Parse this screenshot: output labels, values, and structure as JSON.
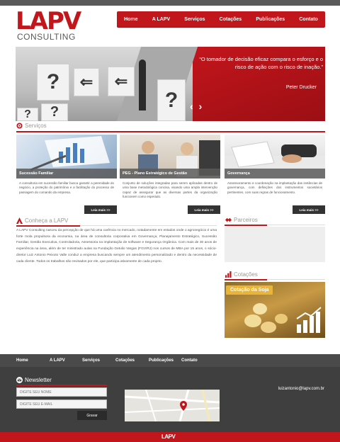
{
  "logo": {
    "mark": "LAPV",
    "subtitle": "CONSULTING"
  },
  "nav": [
    "Home",
    "A LAPV",
    "Serviços",
    "Cotações",
    "Publicações",
    "Contato"
  ],
  "banner": {
    "quote": "“O tomador de decisão eficaz compara o esforço e o risco de ação com o risco de inação.”",
    "author": "Peter Drucker"
  },
  "services": {
    "title": "Serviços",
    "cards": [
      {
        "caption": "Sucessão Familiar",
        "text": "A consultoria em sucessão familiar busca garantir a perenidade do negócio, a proteção do patrimônio e a facilitação do processo de passagem do comando da empresa.",
        "button": "Leia mais >>"
      },
      {
        "caption": "PEG - Plano Estratégico de Gestão",
        "text": "Conjunto de soluções integradas para serem aplicadas dentro de uma base metodológica concisa, visando uma ampla intervenção capaz de assegurar que as diversas partes da organização funcionem como esperado.",
        "button": "Leia mais >>"
      },
      {
        "caption": "Governança",
        "text": "Assessoramento e coordenação na implantação das instâncias de governança, com definições dos instrumentos societários pertinentes, com suas regras de funcionamento.",
        "button": "Leia mais >>"
      }
    ]
  },
  "about": {
    "title": "Conheça a LAPV",
    "text": "A LAPV Consulting nasceu da percepção de que há uma carência no mercado, notadamente em estados onde o agronegócio é uma forte mola propulsora da economia, na área de consultoria corporativa em Governança, Planejamento Estratégico, Sucessão Familiar, Gestão Executiva, Controladoria, Assessoria na implantação de software e Segurança Orgânica. Com mais de 30 anos de experiência na área, além de ter ministrado aulas na Fundação Getulio Vargas (FGV/RJ) nos cursos de MBA por 15 anos, o sócio-diretor Luiz Antonio Peixoto Valle conduz a empresa buscando sempre um atendimento personalizado e dentro da necessidade de cada cliente. Todos os trabalhos são revisados por ele, que participa ativamente de cada projeto."
  },
  "partners": {
    "title": "Parceiros"
  },
  "quotes": {
    "title": "Cotações",
    "label": "Cotação da Soja"
  },
  "footer": {
    "nav": [
      "Home",
      "A LAPV",
      "Serviços",
      "Cotações",
      "Publicações",
      "Contato"
    ],
    "newsletter": {
      "title": "Newsletter",
      "name_placeholder": "DIGITE SEU NOME",
      "email_placeholder": "DIGITE SEU E-MAIL",
      "button": "Gravar"
    },
    "email": "luizantonio@lapv.com.br",
    "bottom_logo": "LAPV"
  },
  "colors": {
    "brand": "#c0161c",
    "footer": "#3f3f3f",
    "cotacao": "#e8b43a"
  }
}
